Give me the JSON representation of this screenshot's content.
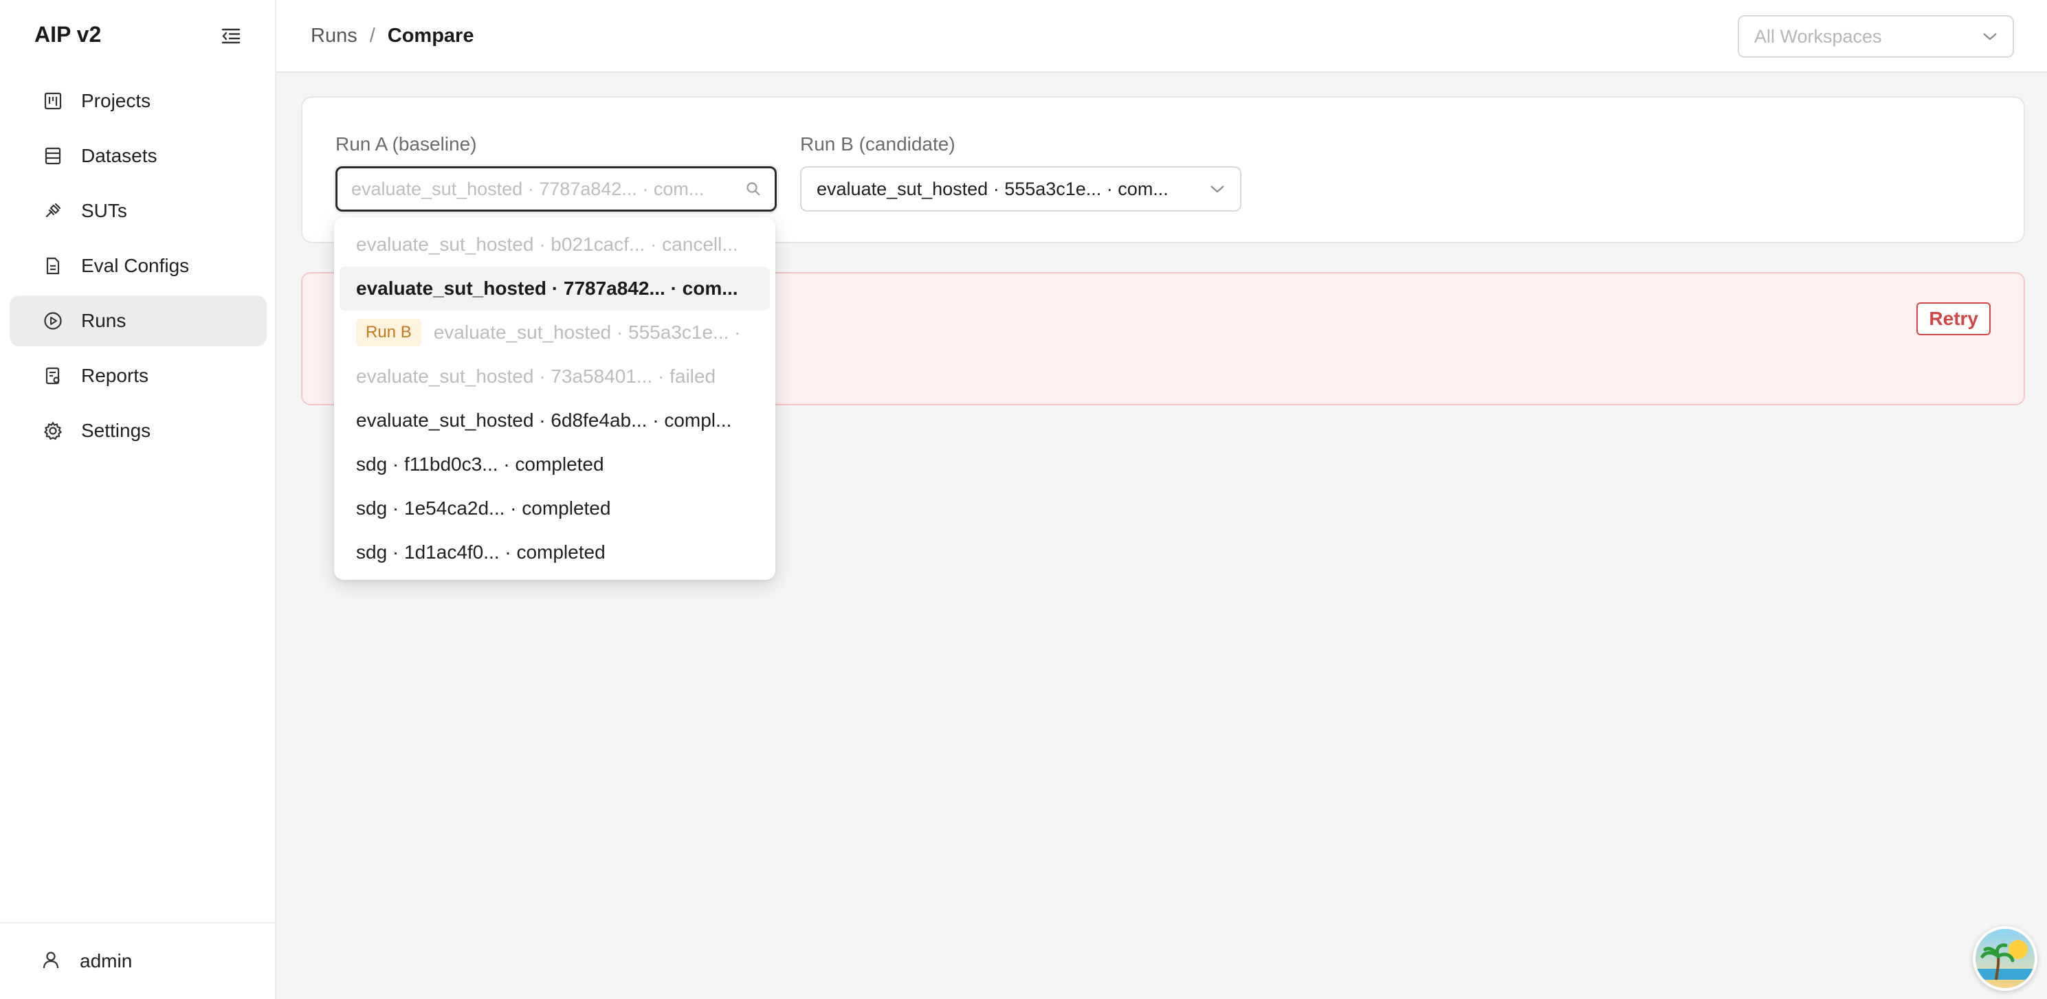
{
  "app": {
    "brand": "AIP v2"
  },
  "sidebar": {
    "items": [
      {
        "label": "Projects",
        "icon": "projects-icon",
        "active": false
      },
      {
        "label": "Datasets",
        "icon": "datasets-icon",
        "active": false
      },
      {
        "label": "SUTs",
        "icon": "suts-icon",
        "active": false
      },
      {
        "label": "Eval Configs",
        "icon": "eval-configs-icon",
        "active": false
      },
      {
        "label": "Runs",
        "icon": "runs-icon",
        "active": true
      },
      {
        "label": "Reports",
        "icon": "reports-icon",
        "active": false
      },
      {
        "label": "Settings",
        "icon": "gear-icon",
        "active": false
      }
    ],
    "footer_user": "admin"
  },
  "header": {
    "breadcrumb": {
      "parent": "Runs",
      "separator": "/",
      "current": "Compare"
    },
    "workspace_placeholder": "All Workspaces"
  },
  "compare": {
    "run_a_label": "Run A (baseline)",
    "run_a_placeholder": "evaluate_sut_hosted · 7787a842... · com...",
    "run_b_label": "Run B (candidate)",
    "run_b_value": "evaluate_sut_hosted · 555a3c1e... · com..."
  },
  "error": {
    "retry_label": "Retry"
  },
  "dropdown": {
    "options": [
      {
        "text": "evaluate_sut_hosted · b021cacf... · cancell...",
        "state": "disabled",
        "tag": ""
      },
      {
        "text": "evaluate_sut_hosted · 7787a842... · com...",
        "state": "selected",
        "tag": ""
      },
      {
        "text": "evaluate_sut_hosted · 555a3c1e... ·",
        "state": "disabled",
        "tag": "Run B"
      },
      {
        "text": "evaluate_sut_hosted · 73a58401... · failed",
        "state": "disabled",
        "tag": ""
      },
      {
        "text": "evaluate_sut_hosted · 6d8fe4ab... · compl...",
        "state": "normal",
        "tag": ""
      },
      {
        "text": "sdg · f11bd0c3... · completed",
        "state": "normal",
        "tag": ""
      },
      {
        "text": "sdg · 1e54ca2d... · completed",
        "state": "normal",
        "tag": ""
      },
      {
        "text": "sdg · 1d1ac4f0... · completed",
        "state": "normal",
        "tag": ""
      }
    ]
  },
  "colors": {
    "accent_error": "#d24545",
    "error_bg": "#fdf0f0",
    "run_b_tag_bg": "#fff3e0",
    "run_b_tag_fg": "#c47a1a"
  }
}
